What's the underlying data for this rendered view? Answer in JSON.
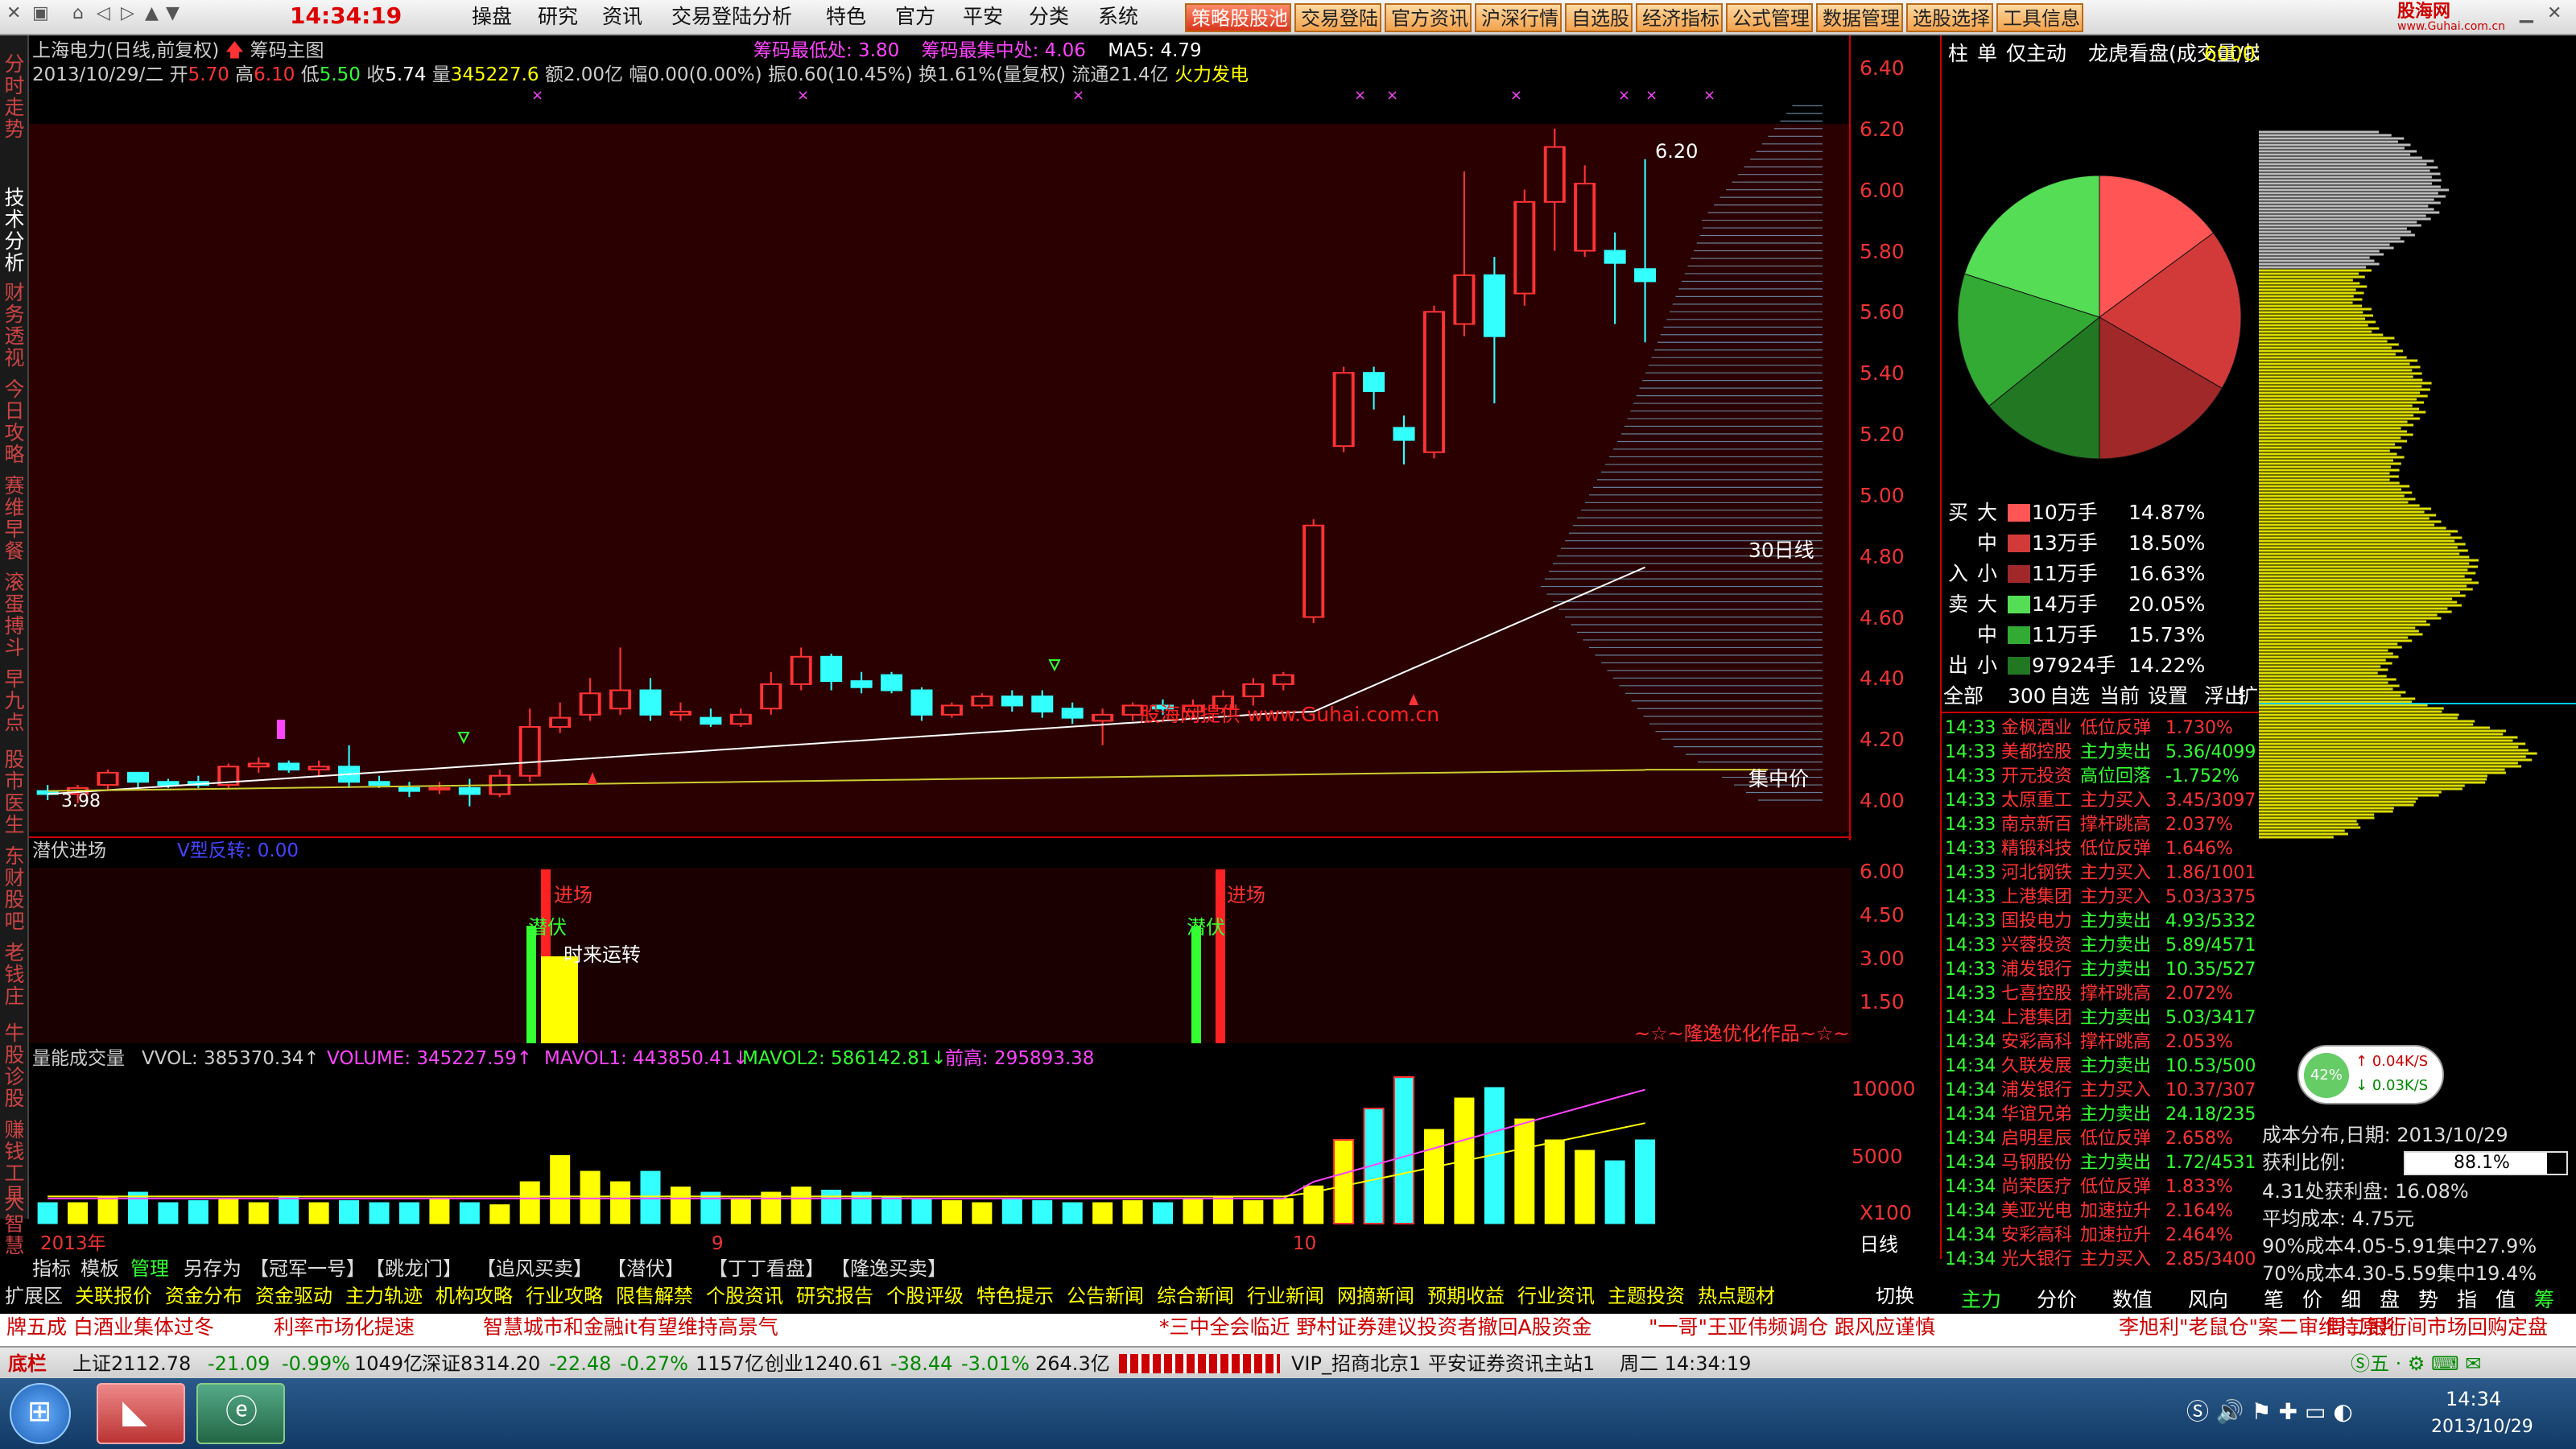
{
  "topbar": {
    "time": "14:34:19",
    "menu": [
      "操盘",
      "研究",
      "资讯",
      "交易登陆分析",
      "特色",
      "官方",
      "平安",
      "分类",
      "系统"
    ],
    "buttons": [
      "策略股股池",
      "交易登陆",
      "官方资讯",
      "沪深行情",
      "自选股",
      "经济指标",
      "公式管理",
      "数据管理",
      "选股选择",
      "工具信息"
    ],
    "logo": "股海网",
    "logo_sub": "www.Guhai.com.cn"
  },
  "left_tabs": [
    "分时走势",
    "技术分析",
    "财务透视",
    "今日攻略",
    "赛维早餐",
    "滚蛋搏斗",
    "早九点",
    "股市医生",
    "东财股吧",
    "老钱庄",
    "牛股诊股",
    "赚钱工具",
    "大智慧"
  ],
  "header": {
    "stock_name": "上海电力(日线,前复权)",
    "indicator": "筹码主图",
    "date": "2013/10/29/二",
    "open_label": "开",
    "open": "5.70",
    "high_label": "高",
    "high": "6.10",
    "low_label": "低",
    "low": "5.50",
    "close_label": "收",
    "close": "5.74",
    "vol_label": "量",
    "vol": "345227.6",
    "amount": "额2.00亿",
    "change": "幅0.00(0.00%)",
    "amp": "振0.60(10.45%)",
    "turnover": "换1.61%(量复权)",
    "float": "流通21.4亿",
    "extra": "火力发电",
    "chip_low": "筹码最低处: 3.80",
    "chip_center": "筹码最集中处: 4.06",
    "ma5": "MA5: 4.79"
  },
  "price_axis": [
    "6.40",
    "6.20",
    "6.00",
    "5.80",
    "5.60",
    "5.40",
    "5.20",
    "5.00",
    "4.80",
    "4.60",
    "4.40",
    "4.20",
    "4.00"
  ],
  "annotations": {
    "high_mark": "6.20",
    "low_mark": "3.98",
    "ma30": "30日线",
    "cost_center": "集中价",
    "watermark": "股海网提供 www.Guhai.com.cn"
  },
  "indicator2": {
    "title": "潜伏进场",
    "sub": "V型反转: 0.00",
    "label_enter": "进场",
    "label_hide": "潜伏",
    "label_turn": "时来运转",
    "axis": [
      "6.00",
      "4.50",
      "3.00",
      "1.50"
    ],
    "footer": "~☆~隆逸优化作品~☆~"
  },
  "volume": {
    "title": "量能成交量",
    "vvol": "VVOL: 385370.34↑",
    "volume": "VOLUME: 345227.59↑",
    "mavol1": "MAVOL1: 443850.41↓",
    "mavol2": "MAVOL2: 586142.81↓",
    "prev_high": "前高: 295893.38",
    "axis": [
      "10000",
      "5000"
    ],
    "unit": "X100"
  },
  "time_axis": {
    "year": "2013年",
    "m9": "9",
    "m10": "10",
    "label": "日线"
  },
  "bottom_tabs": [
    "指标",
    "模板",
    "管理",
    "另存为",
    "【冠军一号】",
    "【跳龙门】",
    "【追风买卖】",
    "【潜伏】",
    "【丁丁看盘】",
    "【隆逸买卖】"
  ],
  "ext_tabs": [
    "扩展区",
    "关联报价",
    "资金分布",
    "资金驱动",
    "主力轨迹",
    "机构攻略",
    "行业攻略",
    "限售解禁",
    "个股资讯",
    "研究报告",
    "个股评级",
    "特色提示",
    "公告新闻",
    "综合新闻",
    "行业新闻",
    "网摘新闻",
    "预期收益",
    "行业资讯",
    "主题投资",
    "热点题材"
  ],
  "right_panel": {
    "tabs_top": [
      "柱",
      "单",
      "仅主动",
      "龙虎看盘(成交量/技所)"
    ],
    "code": "600021",
    "flow": [
      {
        "side": "买",
        "size": "大",
        "amt": "10万手",
        "pct": "14.87%",
        "color": "#ff5555"
      },
      {
        "side": "",
        "size": "中",
        "amt": "13万手",
        "pct": "18.50%",
        "color": "#d23a3a"
      },
      {
        "side": "入",
        "size": "小",
        "amt": "11万手",
        "pct": "16.63%",
        "color": "#a02828"
      },
      {
        "side": "卖",
        "size": "大",
        "amt": "14万手",
        "pct": "20.05%",
        "color": "#55dd55"
      },
      {
        "side": "",
        "size": "中",
        "amt": "11万手",
        "pct": "15.73%",
        "color": "#33aa33"
      },
      {
        "side": "出",
        "size": "小",
        "amt": "97924手",
        "pct": "14.22%",
        "color": "#227722"
      }
    ],
    "filter_tabs": [
      "全部",
      "300",
      "自选",
      "当前",
      "设置",
      "浮出",
      "扩大"
    ],
    "tape": [
      [
        "14:33",
        "金枫酒业",
        "低位反弹",
        "1.730%"
      ],
      [
        "14:33",
        "美都控股",
        "主力卖出",
        "5.36/4099"
      ],
      [
        "14:33",
        "开元投资",
        "高位回落",
        "-1.752%"
      ],
      [
        "14:33",
        "太原重工",
        "主力买入",
        "3.45/3097"
      ],
      [
        "14:33",
        "南京新百",
        "撑杆跳高",
        "2.037%"
      ],
      [
        "14:33",
        "精锻科技",
        "低位反弹",
        "1.646%"
      ],
      [
        "14:33",
        "河北钢铁",
        "主力买入",
        "1.86/1001"
      ],
      [
        "14:33",
        "上港集团",
        "主力买入",
        "5.03/3375"
      ],
      [
        "14:33",
        "国投电力",
        "主力卖出",
        "4.93/5332"
      ],
      [
        "14:33",
        "兴蓉投资",
        "主力卖出",
        "5.89/4571"
      ],
      [
        "14:33",
        "浦发银行",
        "主力卖出",
        "10.35/527"
      ],
      [
        "14:33",
        "七喜控股",
        "撑杆跳高",
        "2.072%"
      ],
      [
        "14:34",
        "上港集团",
        "主力卖出",
        "5.03/3417"
      ],
      [
        "14:34",
        "安彩高科",
        "撑杆跳高",
        "2.053%"
      ],
      [
        "14:34",
        "久联发展",
        "主力卖出",
        "10.53/500"
      ],
      [
        "14:34",
        "浦发银行",
        "主力买入",
        "10.37/307"
      ],
      [
        "14:34",
        "华谊兄弟",
        "主力卖出",
        "24.18/235"
      ],
      [
        "14:34",
        "启明星辰",
        "低位反弹",
        "2.658%"
      ],
      [
        "14:34",
        "马钢股份",
        "主力卖出",
        "1.72/4531"
      ],
      [
        "14:34",
        "尚荣医疗",
        "低位反弹",
        "1.833%"
      ],
      [
        "14:34",
        "美亚光电",
        "加速拉升",
        "2.164%"
      ],
      [
        "14:34",
        "安彩高科",
        "加速拉升",
        "2.464%"
      ],
      [
        "14:34",
        "光大银行",
        "主力买入",
        "2.85/3400"
      ]
    ],
    "bottom_tabs": [
      "主力",
      "分价",
      "数值",
      "风向"
    ],
    "switch": "切换"
  },
  "pie_data": {
    "slices": [
      {
        "label": "买大",
        "pct": 14.87,
        "color": "#ff5555"
      },
      {
        "label": "买中",
        "pct": 18.5,
        "color": "#d23a3a"
      },
      {
        "label": "买小",
        "pct": 16.63,
        "color": "#a02828"
      },
      {
        "label": "卖小",
        "pct": 14.22,
        "color": "#227722"
      },
      {
        "label": "卖中",
        "pct": 15.73,
        "color": "#33aa33"
      },
      {
        "label": "卖大",
        "pct": 20.05,
        "color": "#55dd55"
      }
    ]
  },
  "chip_panel": {
    "speed_pct": "42%",
    "speed_up": "0.04K/S",
    "speed_down": "0.03K/S",
    "date_label": "成本分布,日期: 2013/10/29",
    "profit_label": "获利比例:",
    "profit_value": "88.1%",
    "profit_pos": 0.881,
    "profit_at": "4.31处获利盘: 16.08%",
    "avg_cost": "平均成本: 4.75元",
    "c90": "90%成本4.05-5.91集中27.9%",
    "c70": "70%成本4.30-5.59集中19.4%",
    "tabs": [
      "笔",
      "价",
      "细",
      "盘",
      "势",
      "指",
      "值",
      "筹"
    ]
  },
  "news": [
    "牌五成 白酒业集体过冬",
    "利率市场化提速",
    "智慧城市和金融it有望维持高景气",
    "*三中全会临近 野村证券建议投资者撤回A股资金",
    "\"一哥\"王亚伟频调仓 跟风应谨慎",
    "李旭利\"老鼠仓\"案二审维持原判",
    "周二银行间市场回购定盘"
  ],
  "status": {
    "label": "底栏",
    "sh": "上证2112.78",
    "sh_chg": "-21.09",
    "sh_pct": "-0.99%",
    "sh_amt": "1049亿",
    "sz": "深证8314.20",
    "sz_chg": "-22.48",
    "sz_pct": "-0.27%",
    "sz_amt": "1157亿",
    "cy": "创业1240.61",
    "cy_chg": "-38.44",
    "cy_pct": "-3.01%",
    "cy_amt": "264.3亿",
    "server": "VIP_招商北京1",
    "source": "平安证券资讯主站1",
    "day_time": "周二 14:34:19"
  },
  "taskbar": {
    "time": "14:34",
    "date": "2013/10/29"
  }
}
